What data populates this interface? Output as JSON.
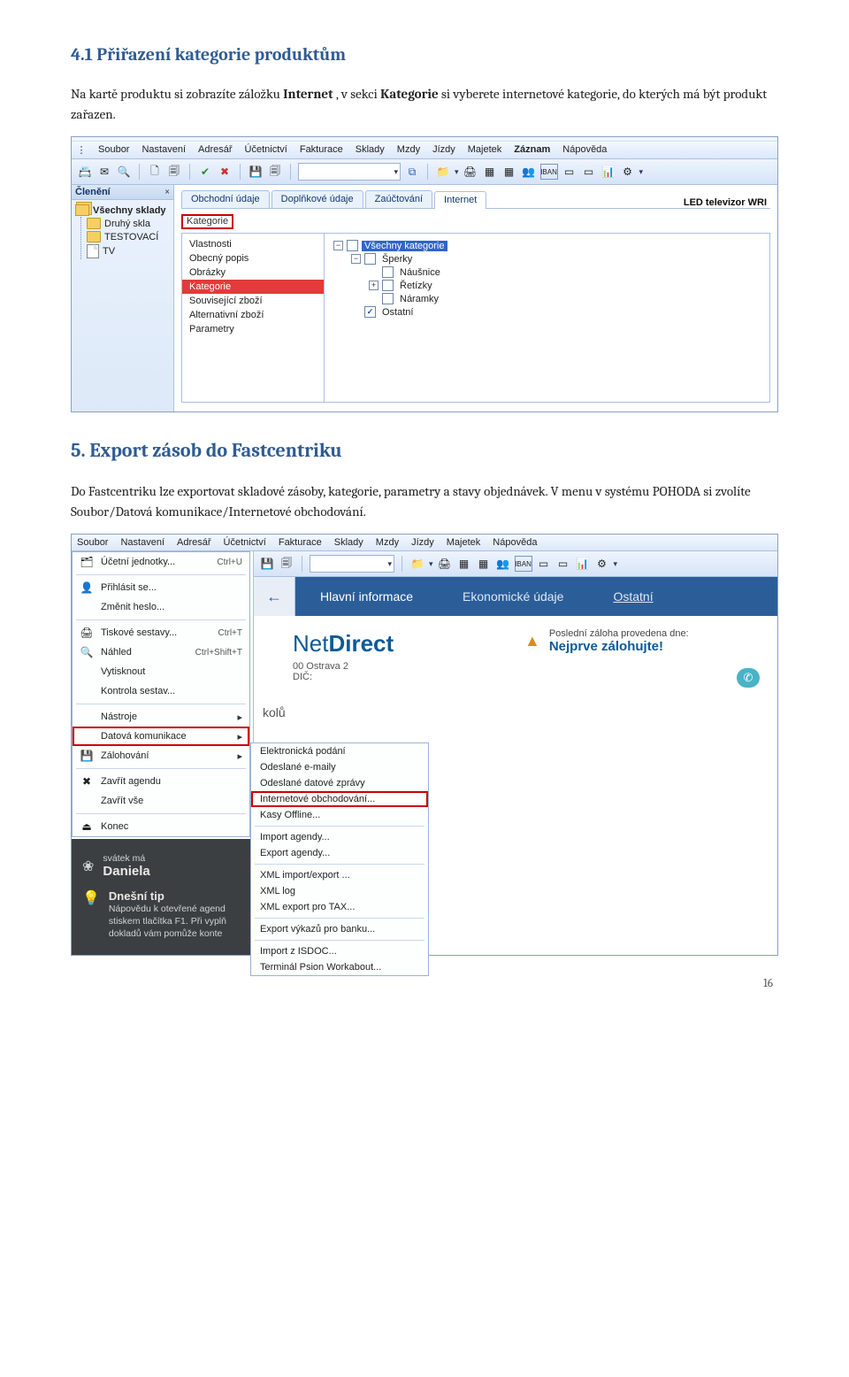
{
  "h_section": "4.1 Přiřazení kategorie produktům",
  "p1_a": "Na kartě produktu si zobrazíte záložku ",
  "p1_b": "Internet",
  "p1_c": ", v sekci ",
  "p1_d": "Kategorie",
  "p1_e": " si vyberete internetové kategorie, do kterých má být produkt zařazen.",
  "menubar": [
    "Soubor",
    "Nastavení",
    "Adresář",
    "Účetnictví",
    "Fakturace",
    "Sklady",
    "Mzdy",
    "Jízdy",
    "Majetek",
    "Záznam",
    "Nápověda"
  ],
  "left_tree_header": "Členění",
  "left_tree_root": "Všechny sklady",
  "left_tree_items": [
    "Druhý skla",
    "TESTOVACÍ",
    "TV"
  ],
  "tabs": [
    "Obchodní údaje",
    "Doplňkové údaje",
    "Zaúčtování",
    "Internet"
  ],
  "tabs_aux_title": "LED televizor WRI",
  "sub_label": "Kategorie",
  "left_list": [
    "Vlastnosti",
    "Obecný popis",
    "Obrázky",
    "Kategorie",
    "Související zboží",
    "Alternativní zboží",
    "Parametry"
  ],
  "left_list_selected": "Kategorie",
  "cat_root": "Všechny kategorie",
  "cat_items": [
    {
      "label": "Šperky",
      "children": [
        "Náušnice",
        "Řetízky",
        "Náramky"
      ],
      "checked": false
    },
    {
      "label": "Ostatní",
      "children": [],
      "checked": true
    }
  ],
  "h_export": "5. Export zásob do Fastcentriku",
  "p2": "Do Fastcentriku lze exportovat skladové zásoby, kategorie, parametry a stavy objednávek. V menu v systému POHODA si zvolíte Soubor/Datová komunikace/Internetové obchodování.",
  "file_menu": [
    {
      "label": "Účetní jednotky...",
      "accel": "Ctrl+U",
      "icon": "🗂"
    },
    {
      "sep": true
    },
    {
      "label": "Přihlásit se...",
      "icon": "👤"
    },
    {
      "label": "Změnit heslo..."
    },
    {
      "sep": true
    },
    {
      "label": "Tiskové sestavy...",
      "accel": "Ctrl+T",
      "icon": "🖨"
    },
    {
      "label": "Náhled",
      "accel": "Ctrl+Shift+T",
      "icon": "🔍"
    },
    {
      "label": "Vytisknout"
    },
    {
      "label": "Kontrola sestav..."
    },
    {
      "sep": true
    },
    {
      "label": "Nástroje",
      "arrow": true
    },
    {
      "label": "Datová komunikace",
      "arrow": true,
      "boxed": true
    },
    {
      "label": "Zálohování",
      "arrow": true,
      "icon": "💾"
    },
    {
      "sep": true
    },
    {
      "label": "Zavřít agendu",
      "icon": "✖"
    },
    {
      "label": "Zavřít vše"
    },
    {
      "sep": true
    },
    {
      "label": "Konec",
      "icon": "⏏"
    }
  ],
  "sub_menu": [
    {
      "label": "Elektronická podání"
    },
    {
      "label": "Odeslané e-maily"
    },
    {
      "label": "Odeslané datové zprávy"
    },
    {
      "label": "Internetové obchodování...",
      "boxed": true
    },
    {
      "label": "Kasy Offline..."
    },
    {
      "sep": true
    },
    {
      "label": "Import agendy..."
    },
    {
      "label": "Export agendy..."
    },
    {
      "sep": true
    },
    {
      "label": "XML import/export ..."
    },
    {
      "label": "XML log"
    },
    {
      "label": "XML export pro TAX..."
    },
    {
      "sep": true
    },
    {
      "label": "Export výkazů pro banku..."
    },
    {
      "sep": true
    },
    {
      "label": "Import z ISDOC..."
    },
    {
      "label": "Terminál Psion Workabout..."
    }
  ],
  "dark": {
    "svatek_lbl": "svátek má",
    "svatek_name": "Daniela",
    "tip_title": "Dnešní tip",
    "tip_text": "Nápovědu k otevřené agend stiskem tlačítka F1. Při vyplň dokladů vám pomůže konte"
  },
  "right_tabs": {
    "main": "Hlavní informace",
    "eco": "Ekonomické údaje",
    "other": "Ostatní"
  },
  "logo": "NetDirect",
  "addr_city": "00 Ostrava 2",
  "addr_dic": "DIČ:",
  "warn_small": "Poslední záloha provedena dne:",
  "warn_big": "Nejprve zálohujte!",
  "kolu": "kolů",
  "page": "16"
}
